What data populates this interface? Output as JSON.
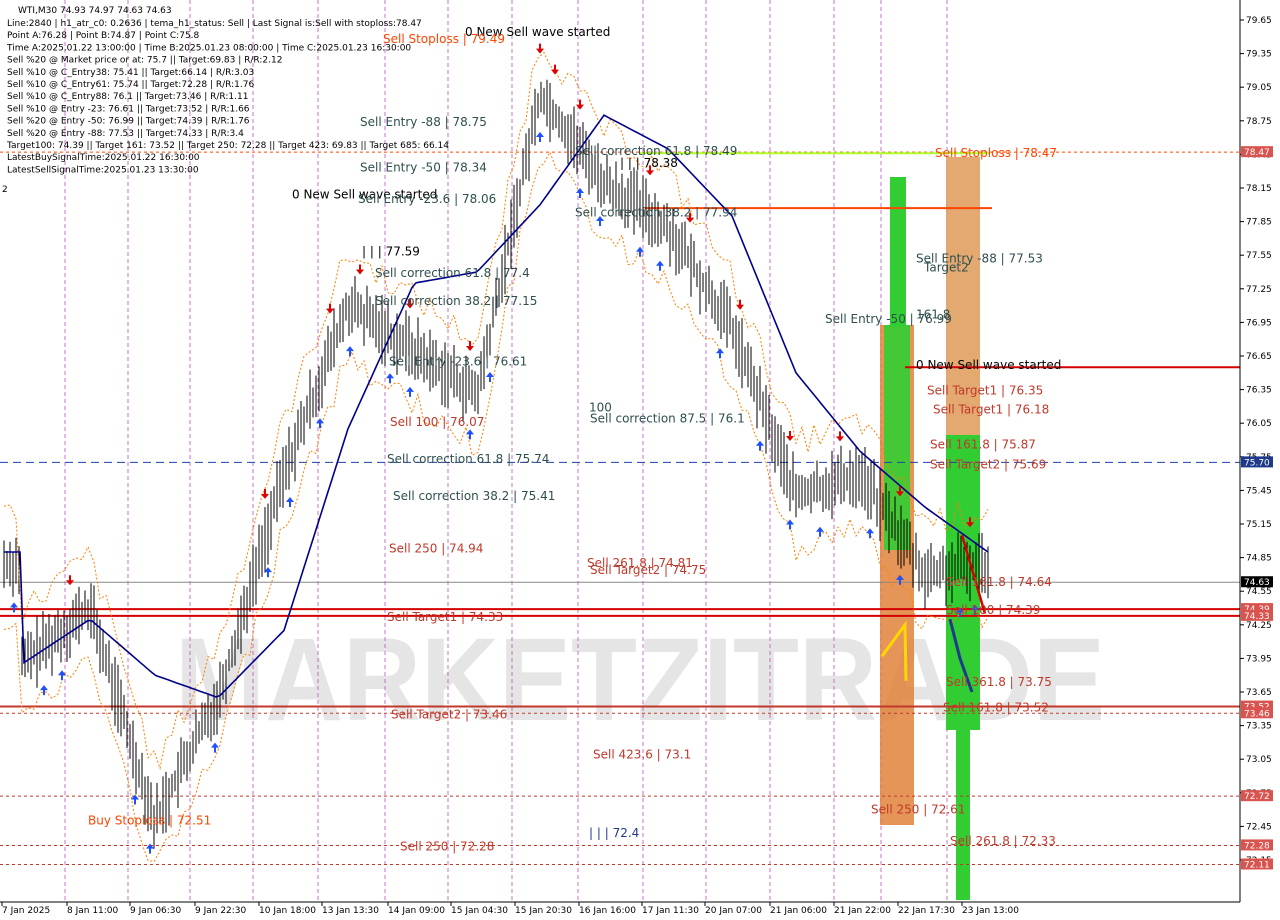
{
  "header": {
    "symbol_line": "WTI,M30  74.93 74.97 74.63 74.63",
    "info_lines": [
      "Line:2840 | h1_atr_c0: 0.2636 | tema_h1_status: Sell | Last Signal is:Sell with stoploss:78.47",
      "Point A:76.28 | Point B:74.87 | Point C:75.8",
      "Time A:2025.01.22 13:00:00 | Time B:2025.01.23 08:00:00 | Time C:2025.01.23 16:30:00",
      "Sell %20 @ Market price or at: 75.7 || Target:69.83 | R/R:2.12",
      "Sell %10 @ C_Entry38: 75.41 || Target:66.14 | R/R:3.03",
      "Sell %10 @ C_Entry61: 75.74 || Target:72.28 | R/R:1.76",
      "Sell %10 @ C_Entry88: 76.1 || Target:73.46 | R/R:1.11",
      "Sell %10 @ Entry -23: 76.61 || Target:73.52 | R/R:1.66",
      "Sell %20 @ Entry -50: 76.99 || Target:74.39 | R/R:1.76",
      "Sell %20 @ Entry -88: 77.53 || Target:74.33 | R/R:3.4",
      "Target100: 74.39 || Target 161: 73.52 || Target 250: 72.28 || Target 423: 69.83 || Target 685: 66.14",
      "LatestBuySignalTime:2025.01.22 16:30:00",
      "LatestSellSignalTime:2025.01.23 13:30:00"
    ],
    "left_edge_mark": "2"
  },
  "watermark": "MARKETZITRADE",
  "colors": {
    "sell_level": "#c0392b",
    "stoploss": "#ff4500",
    "entry": "#2f4f4f",
    "band_green": "#32cd32",
    "band_orange": "#e0823a",
    "ma_line": "#00008b",
    "price_tag_red": "#d9534f",
    "price_tag_dark": "#000000",
    "price_tag_blue": "#1e3a8a"
  },
  "price_axis": {
    "ticks": [
      "79.65",
      "79.35",
      "79.05",
      "78.75",
      "78.45",
      "78.15",
      "77.85",
      "77.55",
      "77.25",
      "76.95",
      "76.65",
      "76.35",
      "76.05",
      "75.75",
      "75.45",
      "75.15",
      "74.85",
      "74.55",
      "74.25",
      "73.95",
      "73.65",
      "73.35",
      "73.05",
      "72.75",
      "72.45",
      "72.15"
    ],
    "tags": [
      {
        "text": "78.47",
        "kind": "red"
      },
      {
        "text": "75.70",
        "kind": "blue"
      },
      {
        "text": "74.63",
        "kind": "dark"
      },
      {
        "text": "74.39",
        "kind": "red"
      },
      {
        "text": "74.33",
        "kind": "red"
      },
      {
        "text": "73.52",
        "kind": "red"
      },
      {
        "text": "73.46",
        "kind": "red"
      },
      {
        "text": "72.72",
        "kind": "red"
      },
      {
        "text": "72.28",
        "kind": "red"
      },
      {
        "text": "72.11",
        "kind": "red"
      }
    ]
  },
  "time_axis": [
    "7 Jan 2025",
    "8 Jan 11:00",
    "9 Jan 06:30",
    "9 Jan 22:30",
    "10 Jan 18:00",
    "13 Jan 13:30",
    "14 Jan 09:00",
    "15 Jan 04:30",
    "15 Jan 20:30",
    "16 Jan 16:00",
    "17 Jan 11:30",
    "20 Jan 07:00",
    "21 Jan 06:00",
    "21 Jan 22:00",
    "22 Jan 17:30",
    "23 Jan 13:00"
  ],
  "annotations": [
    {
      "text": "0 New Sell wave started",
      "price": 79.55,
      "color": "#000"
    },
    {
      "text": "Sell Stoploss | 79.49",
      "price": 79.49,
      "color": "#ff4500"
    },
    {
      "text": "Sell Entry -88 | 78.75",
      "price": 78.75,
      "color": "#2f4f4f"
    },
    {
      "text": "| | | 78.38",
      "price": 78.38,
      "color": "#000"
    },
    {
      "text": "Sell correction 61.8 | 78.49",
      "price": 78.49,
      "color": "#2f4f4f"
    },
    {
      "text": "Sell Entry -50 | 78.34",
      "price": 78.34,
      "color": "#2f4f4f"
    },
    {
      "text": "0 New Sell wave started",
      "price": 78.1,
      "color": "#000"
    },
    {
      "text": "Sell Entry -23.6 | 78.06",
      "price": 78.06,
      "color": "#2f4f4f"
    },
    {
      "text": "Sell correction 38.2 | 77.94",
      "price": 77.94,
      "color": "#2f4f4f"
    },
    {
      "text": "| | | 77.59",
      "price": 77.59,
      "color": "#000"
    },
    {
      "text": "Sell correction 61.8 | 77.4",
      "price": 77.4,
      "color": "#2f4f4f"
    },
    {
      "text": "Sell correction 38.2 | 77.15",
      "price": 77.15,
      "color": "#2f4f4f"
    },
    {
      "text": "Sell Stoploss | 78.47",
      "price": 78.47,
      "color": "#ff4500"
    },
    {
      "text": "Sell Entry -88 | 77.53",
      "price": 77.53,
      "color": "#2f4f4f"
    },
    {
      "text": "Target2",
      "price": 77.45,
      "color": "#2f4f4f"
    },
    {
      "text": "161.8",
      "price": 77.03,
      "color": "#2f4f4f"
    },
    {
      "text": "Sell Entry -50 | 76.99",
      "price": 76.99,
      "color": "#2f4f4f"
    },
    {
      "text": "0 New Sell wave started",
      "price": 76.58,
      "color": "#000"
    },
    {
      "text": "Sell Entry -23.6 | 76.61",
      "price": 76.61,
      "color": "#2f4f4f"
    },
    {
      "text": "Sell Target1 | 76.35",
      "price": 76.35,
      "color": "#c0392b"
    },
    {
      "text": "100",
      "price": 76.2,
      "color": "#2f4f4f"
    },
    {
      "text": "Sell Target1 | 76.18",
      "price": 76.18,
      "color": "#c0392b"
    },
    {
      "text": "Sell correction 87.5 | 76.1",
      "price": 76.1,
      "color": "#2f4f4f"
    },
    {
      "text": "Sell 100 | 76.07",
      "price": 76.07,
      "color": "#c0392b"
    },
    {
      "text": "Sell 161.8 | 75.87",
      "price": 75.87,
      "color": "#c0392b"
    },
    {
      "text": "Sell correction 61.8 | 75.74",
      "price": 75.74,
      "color": "#2f4f4f"
    },
    {
      "text": "Sell Target2 | 75.69",
      "price": 75.69,
      "color": "#c0392b"
    },
    {
      "text": "Sell correction 38.2 | 75.41",
      "price": 75.41,
      "color": "#2f4f4f"
    },
    {
      "text": "Sell 250 | 74.94",
      "price": 74.94,
      "color": "#c0392b"
    },
    {
      "text": "Sell 261.8 | 74.81",
      "price": 74.81,
      "color": "#c0392b"
    },
    {
      "text": "Sell Target2 | 74.75",
      "price": 74.75,
      "color": "#c0392b"
    },
    {
      "text": "Sell 161.8 | 74.64",
      "price": 74.64,
      "color": "#c0392b"
    },
    {
      "text": "Sell 100 | 74.39",
      "price": 74.39,
      "color": "#c0392b"
    },
    {
      "text": "Sell Target1 | 74.33",
      "price": 74.33,
      "color": "#c0392b"
    },
    {
      "text": "Sell 361.8 | 73.75",
      "price": 73.75,
      "color": "#c0392b"
    },
    {
      "text": "Sell 161.8 | 73.52",
      "price": 73.52,
      "color": "#c0392b"
    },
    {
      "text": "Sell Target2 | 73.46",
      "price": 73.46,
      "color": "#c0392b"
    },
    {
      "text": "Sell 423.6 | 73.1",
      "price": 73.1,
      "color": "#c0392b"
    },
    {
      "text": "Sell 250 | 72.61",
      "price": 72.61,
      "color": "#c0392b"
    },
    {
      "text": "Buy Stoploss | 72.51",
      "price": 72.51,
      "color": "#ff4500"
    },
    {
      "text": "| | | 72.4",
      "price": 72.4,
      "color": "#1e3a8a"
    },
    {
      "text": "Sell 261.8 | 72.33",
      "price": 72.33,
      "color": "#c0392b"
    },
    {
      "text": "Sell 250 | 72.28",
      "price": 72.28,
      "color": "#c0392b"
    }
  ],
  "chart_data": {
    "type": "line",
    "title": "WTI,M30",
    "ylim": [
      72.1,
      79.8
    ],
    "grid": false,
    "ohlc_last": {
      "open": 74.93,
      "high": 74.97,
      "low": 74.63,
      "close": 74.63
    },
    "x": [
      "7 Jan 2025",
      "8 Jan 11:00",
      "9 Jan 06:30",
      "9 Jan 22:30",
      "10 Jan 18:00",
      "13 Jan 13:30",
      "14 Jan 09:00",
      "15 Jan 04:30",
      "15 Jan 20:30",
      "16 Jan 16:00",
      "17 Jan 11:30",
      "20 Jan 07:00",
      "21 Jan 06:00",
      "21 Jan 22:00",
      "22 Jan 17:30",
      "23 Jan 13:00"
    ],
    "series": [
      {
        "values": [
          73.9,
          74.4,
          72.5,
          73.6,
          75.6,
          77.1,
          76.7,
          76.3,
          79.0,
          78.2,
          77.8,
          76.9,
          75.4,
          75.6,
          74.7,
          74.8
        ]
      },
      {
        "values": [
          73.9,
          74.3,
          73.8,
          73.6,
          74.2,
          76.0,
          77.3,
          77.4,
          78.0,
          78.8,
          78.5,
          77.9,
          76.5,
          75.8,
          75.3,
          74.9
        ]
      }
    ],
    "horizontal_levels": [
      78.47,
      75.7,
      74.63,
      74.39,
      74.33,
      73.52,
      73.46,
      72.72,
      72.28,
      72.11
    ]
  }
}
